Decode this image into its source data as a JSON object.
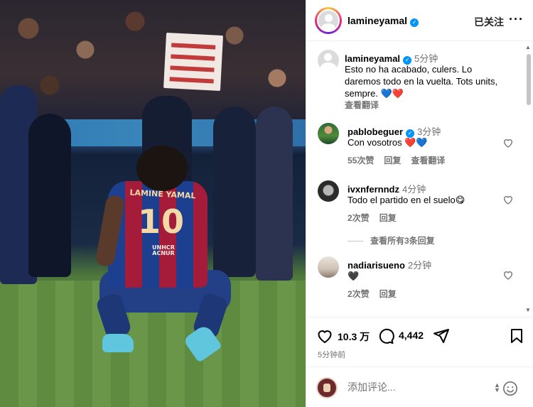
{
  "photo": {
    "jersey_name": "LAMINE YAMAL",
    "jersey_number": "10",
    "sponsor": "UNHCR ACNUR"
  },
  "header": {
    "username": "lamineyamal",
    "follow_label": "已关注",
    "more_label": "···"
  },
  "caption": {
    "username": "lamineyamal",
    "time": "5分钟",
    "lines": [
      "Esto no ha acabado, culers. Lo",
      "daremos todo en la vuelta. Tots units,",
      "sempre. 💙❤️"
    ],
    "translate": "查看翻译"
  },
  "comments": [
    {
      "username": "pablobeguer",
      "verified": true,
      "time": "3分钟",
      "text": "Con vosotros ❤️💙",
      "likes": "55次赞",
      "reply": "回复",
      "translate": "查看翻译"
    },
    {
      "username": "ivxnfernndz",
      "time": "4分钟",
      "text": "Todo el partido en el suelo😋",
      "likes": "2次赞",
      "reply": "回复",
      "view_replies": "查看所有3条回复"
    },
    {
      "username": "nadiarisueno",
      "time": "2分钟",
      "text": "🖤",
      "likes": "2次赞",
      "reply": "回复"
    }
  ],
  "actions": {
    "like_count": "10.3 万",
    "comment_count": "4,442",
    "post_time": "5分钟前"
  },
  "compose": {
    "placeholder": "添加评论..."
  },
  "colors": {
    "verified_blue": "#0095f6",
    "muted_text": "#737373",
    "divider": "#efefef"
  },
  "icons": [
    "heart-icon",
    "comment-icon",
    "share-icon",
    "bookmark-icon",
    "emoji-icon",
    "more-icon",
    "verified-icon"
  ]
}
